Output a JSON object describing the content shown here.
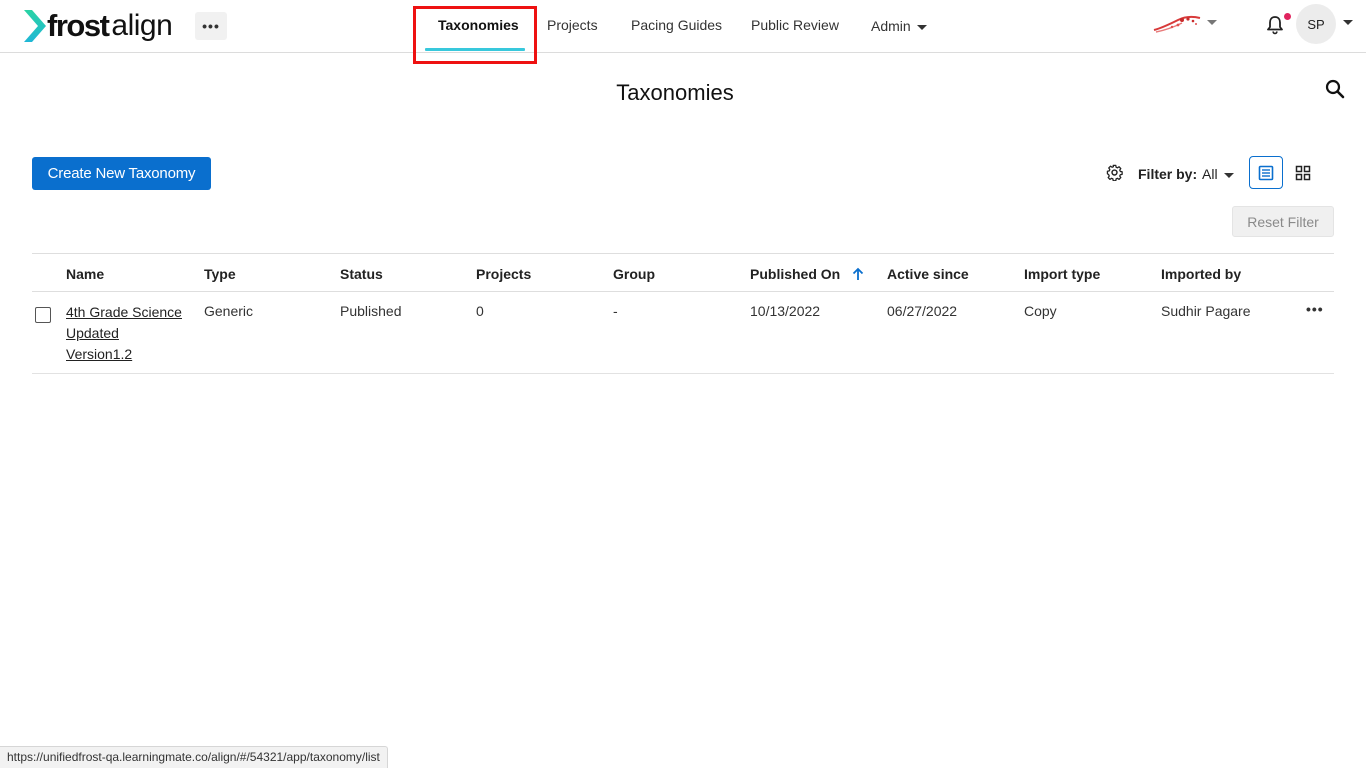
{
  "brand": {
    "name_bold": "frost",
    "name_light": "align"
  },
  "header": {
    "more_label": "•••",
    "nav": [
      {
        "label": "Taxonomies",
        "active": true
      },
      {
        "label": "Projects"
      },
      {
        "label": "Pacing Guides"
      },
      {
        "label": "Public Review"
      },
      {
        "label": "Admin"
      }
    ],
    "avatar_initials": "SP",
    "notification_dot_color": "#e0245e",
    "accent_underline_color": "#38c8dc"
  },
  "page": {
    "title": "Taxonomies"
  },
  "toolbar": {
    "create_label": "Create New Taxonomy",
    "filter_label": "Filter by:",
    "filter_value": "All",
    "reset_label": "Reset Filter",
    "primary_color": "#0a6fce"
  },
  "table": {
    "columns": [
      "Name",
      "Type",
      "Status",
      "Projects",
      "Group",
      "Published On",
      "Active since",
      "Import type",
      "Imported by"
    ],
    "rows": [
      {
        "name": "4th Grade Science Updated Version1.2",
        "type": "Generic",
        "status": "Published",
        "projects": "0",
        "group": "-",
        "published_on": "10/13/2022",
        "active_since": "06/27/2022",
        "import_type": "Copy",
        "imported_by": "Sudhir Pagare",
        "menu_label": "•••"
      }
    ]
  },
  "status_bar": {
    "url": "https://unifiedfrost-qa.learningmate.co/align/#/54321/app/taxonomy/list"
  },
  "icons": [
    "chevron-logo-icon",
    "more-icon",
    "caret-down-icon",
    "bell-icon",
    "search-icon",
    "gear-icon",
    "list-view-icon",
    "grid-view-icon",
    "sort-up-icon"
  ]
}
